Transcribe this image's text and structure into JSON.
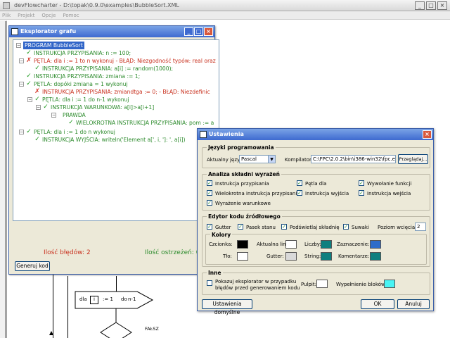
{
  "app": {
    "title": "devFlowcharter - D:\\topak\\0.9.0\\examples\\BubbleSort.XML",
    "menu": [
      "Plik",
      "Projekt",
      "Opcje",
      "Pomoc"
    ],
    "window_controls": {
      "minimize": "_",
      "maximize": "□",
      "close": "×"
    }
  },
  "explorer": {
    "title": "Eksplorator grafu",
    "tree": [
      {
        "icon": "none",
        "expander": "−",
        "text": "PROGRAM BubbleSort",
        "style": "selected",
        "level": 0
      },
      {
        "icon": "check",
        "expander": "",
        "text": "INSTRUKCJA PRZYPISANIA: n := 100;",
        "style": "green",
        "level": 1
      },
      {
        "icon": "cross",
        "expander": "−",
        "text": "PĘTLA: dla i := 1 to n wykonuj - BŁĄD: Niezgodność typów: real oraz",
        "style": "red",
        "level": 1
      },
      {
        "icon": "check",
        "expander": "",
        "text": "INSTRUKCJA PRZYPISANIA: a[i] := random(1000);",
        "style": "green",
        "level": 2
      },
      {
        "icon": "check",
        "expander": "",
        "text": "INSTRUKCJA PRZYPISANIA: zmiana := 1;",
        "style": "green",
        "level": 1
      },
      {
        "icon": "check",
        "expander": "−",
        "text": "PĘTLA: dopóki zmiana = 1 wykonuj",
        "style": "green",
        "level": 1
      },
      {
        "icon": "cross",
        "expander": "",
        "text": "INSTRUKCJA PRZYPISANIA: zmiandtga := 0; - BŁĄD: Niezdefinic",
        "style": "red",
        "level": 2
      },
      {
        "icon": "check",
        "expander": "−",
        "text": "PĘTLA: dla i := 1 do n-1 wykonuj",
        "style": "green",
        "level": 2
      },
      {
        "icon": "check",
        "expander": "−",
        "text": "INSTRUKCJA WARUNKOWA: a[i]>a[i+1]",
        "style": "green",
        "level": 3
      },
      {
        "icon": "none",
        "expander": "−",
        "text": "PRAWDA",
        "style": "green",
        "level": 4
      },
      {
        "icon": "check",
        "expander": "",
        "text": "WIELOKROTNA INSTRUKCJA PRZYPISANIA: pom := a",
        "style": "green",
        "level": 5
      },
      {
        "icon": "check",
        "expander": "−",
        "text": "PĘTLA: dla i := 1 do n wykonuj",
        "style": "green",
        "level": 1
      },
      {
        "icon": "check",
        "expander": "",
        "text": "INSTRUKCJA WYJŚCIA: writeln('Element a[', i, ']: ', a[i])",
        "style": "green",
        "level": 2
      }
    ],
    "errors_label": "Ilość błędów: 2",
    "warnings_label": "Ilość ostrzeżeń: 0",
    "generate_button": "Generuj kod"
  },
  "flowchart": {
    "loop_for": "dla",
    "loop_var": "i",
    "loop_assign": ":= 1",
    "loop_do": "do",
    "loop_end": "n-1",
    "branch_false": "FAŁSZ"
  },
  "settings": {
    "title": "Ustawienia",
    "lang_group": "Języki programowania",
    "current_lang_label": "Aktualny język:",
    "current_lang_value": "Pascal",
    "compiler_label": "Kompilator:",
    "compiler_path": "C:\\FPC\\2.0.2\\bin\\i386-win32\\fpc.exe",
    "browse_button": "Przeglądaj...",
    "syntax_group": "Analiza składni wyrażeń",
    "syntax_options": [
      {
        "label": "Instrukcja przypisania",
        "checked": true
      },
      {
        "label": "Pętla dla",
        "checked": true
      },
      {
        "label": "Wywołanie funkcji",
        "checked": true
      },
      {
        "label": "Wielokrotna instrukcja przypisania",
        "checked": true
      },
      {
        "label": "Instrukcja wyjścia",
        "checked": true
      },
      {
        "label": "Instrukcja wejścia",
        "checked": true
      },
      {
        "label": "Wyrażenie warunkowe",
        "checked": true
      }
    ],
    "editor_group": "Edytor kodu źródłowego",
    "editor_options": [
      {
        "label": "Gutter",
        "checked": true
      },
      {
        "label": "Pasek stanu",
        "checked": true
      },
      {
        "label": "Podświetlaj składnię",
        "checked": true
      },
      {
        "label": "Suwaki",
        "checked": true
      }
    ],
    "indent_label": "Poziom wcięcia:",
    "indent_value": "2",
    "colors_group": "Kolory",
    "color_fields": [
      {
        "label": "Czcionka:",
        "color": "#000000"
      },
      {
        "label": "Aktualna linia:",
        "color": "#ffffff"
      },
      {
        "label": "Liczby:",
        "color": "#0f7f7f"
      },
      {
        "label": "Zaznaczenie:",
        "color": "#2e6cc9"
      },
      {
        "label": "Tło:",
        "color": "#ffffff"
      },
      {
        "label": "Gutter:",
        "color": "#d9d9d9"
      },
      {
        "label": "String:",
        "color": "#0f7f7f"
      },
      {
        "label": "Komentarze:",
        "color": "#0f7f7f"
      }
    ],
    "other_group": "Inne",
    "show_explorer_label_1": "Pokazuj eksplorator w przypadku",
    "show_explorer_label_2": "błędów przed generowaniem kodu",
    "show_explorer_checked": false,
    "desktop_label": "Pulpit:",
    "desktop_color": "#ffffff",
    "block_fill_label": "Wypełnienie bloków:",
    "block_fill_color": "#48f4f4",
    "defaults_button": "Ustawienia domyślne",
    "ok_button": "OK",
    "cancel_button": "Anuluj"
  }
}
